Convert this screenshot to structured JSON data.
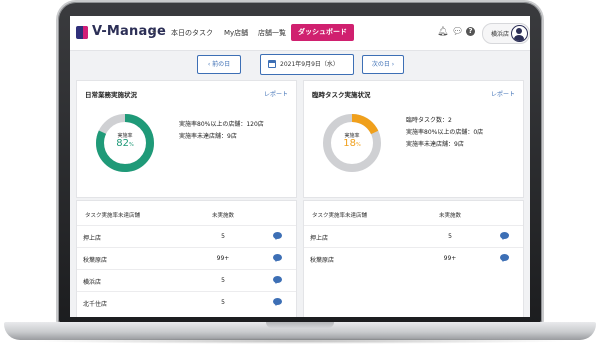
{
  "app": {
    "name": "V-Manage"
  },
  "nav": {
    "items": [
      "本日のタスク",
      "My店舗",
      "店舗一覧"
    ],
    "active": "ダッシュボード"
  },
  "header": {
    "store_name": "横浜店"
  },
  "date_bar": {
    "prev_label": "前の日",
    "date": "2021年9月9日（水）",
    "next_label": "次の日"
  },
  "daily_card": {
    "title": "日常業務実施状況",
    "link": "レポート",
    "donut_label": "実施率",
    "donut_value": "82",
    "donut_unit": "%",
    "donut_fraction": 0.82,
    "stats": [
      "実施率80%以上の店舗：120店",
      "実施率未達店舗：9店"
    ]
  },
  "temp_card": {
    "title": "臨時タスク実施状況",
    "link": "レポート",
    "donut_label": "実施率",
    "donut_value": "18",
    "donut_unit": "%",
    "donut_fraction": 0.18,
    "stats": [
      "臨時タスク数：2",
      "実施率80%以上の店舗：0店",
      "実施率未達店舗：9店"
    ]
  },
  "daily_list": {
    "col1": "タスク実施率未達店舗",
    "col2": "未実施数",
    "rows": [
      {
        "name": "押上店",
        "count": "5"
      },
      {
        "name": "秋葉原店",
        "count": "99+"
      },
      {
        "name": "横浜店",
        "count": "5"
      },
      {
        "name": "北千住店",
        "count": "5"
      }
    ]
  },
  "temp_list": {
    "col1": "タスク実施率未達店舗",
    "col2": "未実施数",
    "rows": [
      {
        "name": "押上店",
        "count": "5"
      },
      {
        "name": "秋葉原店",
        "count": "99+"
      }
    ]
  },
  "colors": {
    "brand_navy": "#2c2f56",
    "brand_magenta": "#d0206f",
    "accent_blue": "#3d6fb5",
    "donut_green": "#1f9a78",
    "donut_orange": "#f0a01c",
    "donut_track": "#cfd0d3"
  }
}
